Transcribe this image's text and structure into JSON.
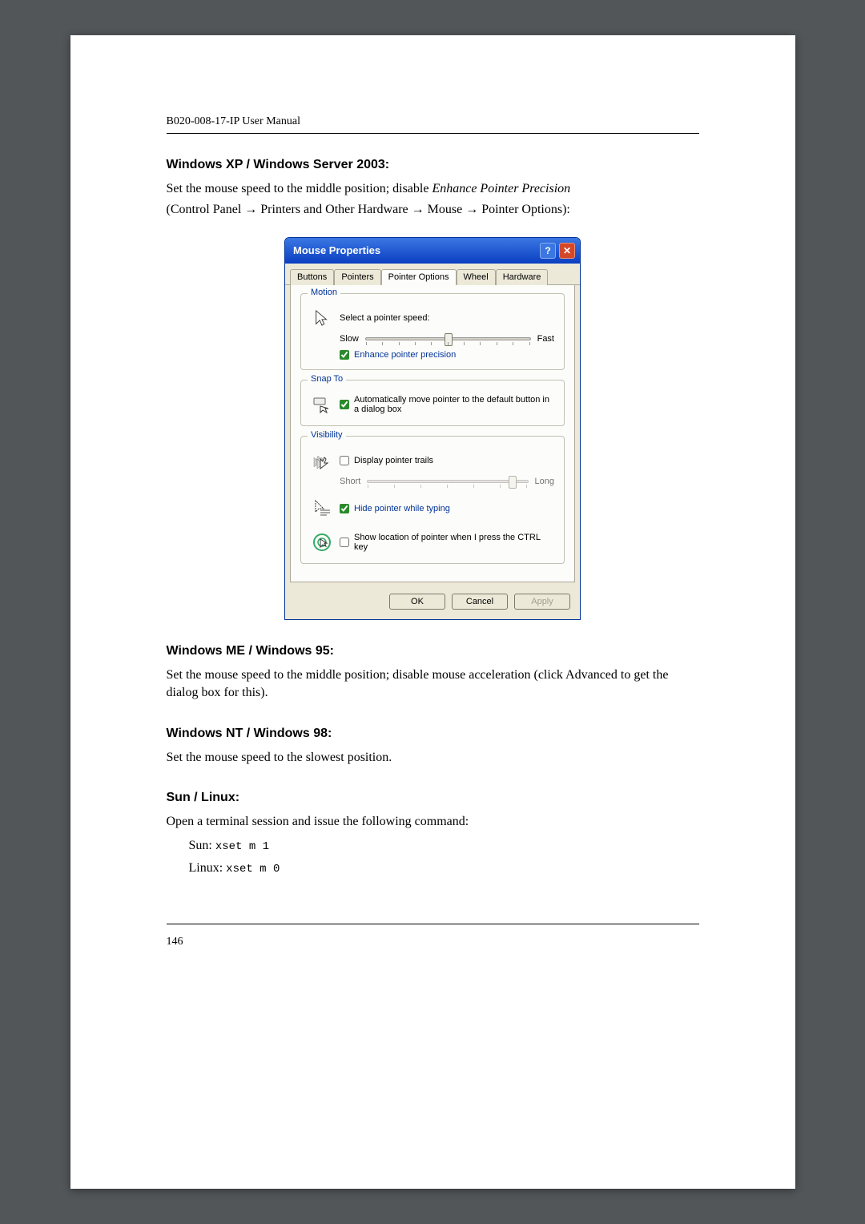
{
  "header": "B020-008-17-IP User Manual",
  "section1": {
    "title": "Windows XP / Windows Server 2003:",
    "para_parts": {
      "p1a": "Set the mouse speed to the middle position; disable ",
      "p1b": "Enhance Pointer Precision",
      "p2": "(Control Panel → Printers and Other Hardware → Mouse → Pointer Options):"
    }
  },
  "dialog": {
    "title": "Mouse Properties",
    "tabs": [
      "Buttons",
      "Pointers",
      "Pointer Options",
      "Wheel",
      "Hardware"
    ],
    "active_tab": 2,
    "motion": {
      "group": "Motion",
      "label": "Select a pointer speed:",
      "slow": "Slow",
      "fast": "Fast",
      "enhance": "Enhance pointer precision",
      "enhance_checked": true
    },
    "snapto": {
      "group": "Snap To",
      "label": "Automatically move pointer to the default button in a dialog box",
      "checked": true
    },
    "visibility": {
      "group": "Visibility",
      "trails": "Display pointer trails",
      "trails_checked": false,
      "short": "Short",
      "long": "Long",
      "hide": "Hide pointer while typing",
      "hide_checked": true,
      "showloc": "Show location of pointer when I press the CTRL key",
      "showloc_checked": false
    },
    "buttons": {
      "ok": "OK",
      "cancel": "Cancel",
      "apply": "Apply"
    }
  },
  "section2": {
    "title": "Windows ME / Windows 95:",
    "para": "Set the mouse speed to the middle position; disable mouse acceleration (click Advanced to get the dialog box for this)."
  },
  "section3": {
    "title": "Windows NT / Windows 98:",
    "para": "Set the mouse speed to the slowest position."
  },
  "section4": {
    "title": "Sun / Linux:",
    "para": "Open a terminal session and issue the following command:",
    "sun_prefix": "Sun: ",
    "sun_cmd": "xset m 1",
    "linux_prefix": "Linux: ",
    "linux_cmd": "xset m 0"
  },
  "page_number": "146"
}
